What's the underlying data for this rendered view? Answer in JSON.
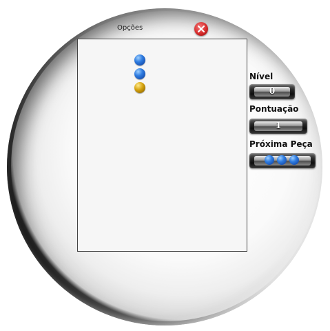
{
  "window": {
    "options_label": "Opções"
  },
  "board": {
    "pieces": [
      {
        "color": "blue",
        "row": 0
      },
      {
        "color": "blue",
        "row": 1
      },
      {
        "color": "yellow",
        "row": 2
      }
    ]
  },
  "stats": {
    "level_label": "Nível",
    "level_value": "0",
    "score_label": "Pontuação",
    "score_value": "1",
    "next_label": "Próxima Peça",
    "next_piece": [
      "blue",
      "blue",
      "blue"
    ]
  },
  "colors": {
    "blue": "#2f7ce0",
    "yellow": "#d4a10c",
    "close": "#d62a2a"
  }
}
